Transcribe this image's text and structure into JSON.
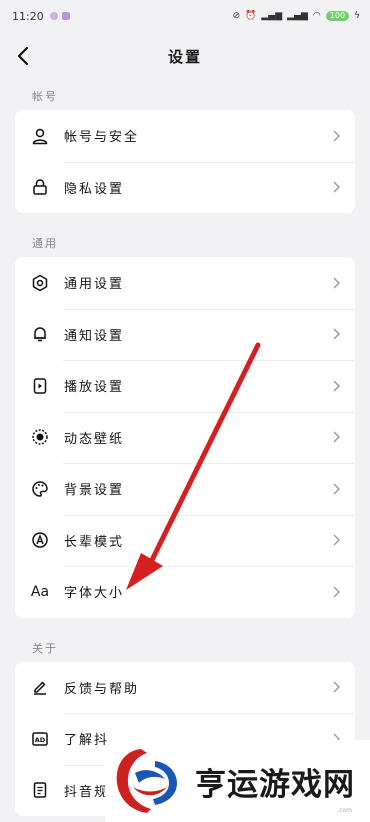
{
  "status_bar": {
    "time": "11:20",
    "battery": "100"
  },
  "header": {
    "title": "设置"
  },
  "sections": [
    {
      "label": "帐号",
      "items": [
        {
          "label": "帐号与安全",
          "icon": "person-icon"
        },
        {
          "label": "隐私设置",
          "icon": "lock-icon"
        }
      ]
    },
    {
      "label": "通用",
      "items": [
        {
          "label": "通用设置",
          "icon": "gear-icon"
        },
        {
          "label": "通知设置",
          "icon": "bell-icon"
        },
        {
          "label": "播放设置",
          "icon": "play-card-icon"
        },
        {
          "label": "动态壁纸",
          "icon": "wallpaper-icon"
        },
        {
          "label": "背景设置",
          "icon": "palette-icon"
        },
        {
          "label": "长辈模式",
          "icon": "elder-mode-icon"
        },
        {
          "label": "字体大小",
          "icon": "font-size-icon",
          "icon_text": "Aa"
        }
      ]
    },
    {
      "label": "关于",
      "items": [
        {
          "label": "反馈与帮助",
          "icon": "pen-icon"
        },
        {
          "label": "了解抖",
          "icon": "ad-icon"
        },
        {
          "label": "抖音规",
          "icon": "document-icon"
        }
      ]
    }
  ],
  "watermark": {
    "text": "亨运游戏网",
    "sub": ".com"
  },
  "colors": {
    "arrow": "#d42020",
    "background": "#f2f2f4",
    "card": "#ffffff"
  }
}
